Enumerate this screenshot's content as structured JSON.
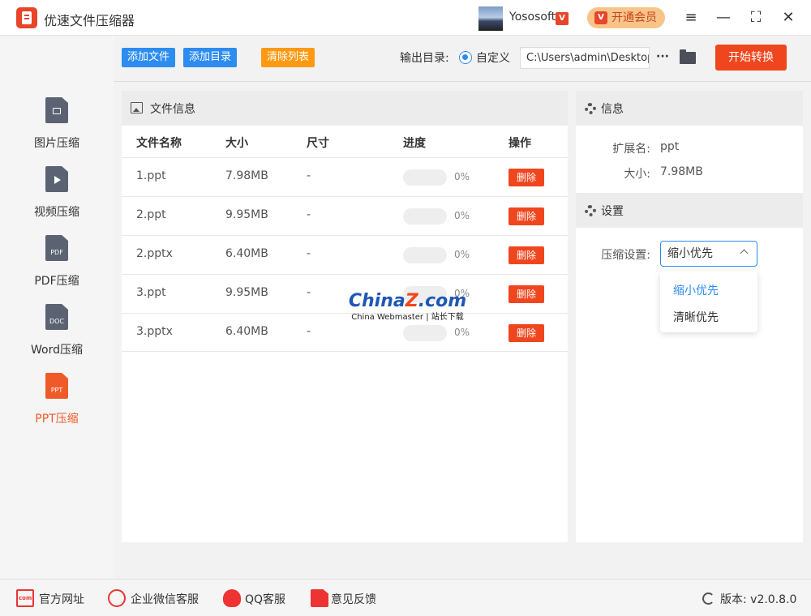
{
  "app": {
    "title": "优速文件压缩器"
  },
  "user": {
    "name": "Yososoft",
    "vip_badge": "V",
    "vip_button": "开通会员",
    "vip_icon": "V"
  },
  "window": {
    "menu": "≡",
    "minimize": "—",
    "maximize": "⛶",
    "close": "✕"
  },
  "sidebar": {
    "items": [
      {
        "label": "图片压缩",
        "tag": "",
        "icon": "image-file-icon"
      },
      {
        "label": "视频压缩",
        "tag": "",
        "icon": "video-file-icon"
      },
      {
        "label": "PDF压缩",
        "tag": "PDF",
        "icon": "pdf-file-icon"
      },
      {
        "label": "Word压缩",
        "tag": "DOC",
        "icon": "doc-file-icon"
      },
      {
        "label": "PPT压缩",
        "tag": "PPT",
        "icon": "ppt-file-icon",
        "active": true
      }
    ]
  },
  "toolbar": {
    "add_file": "添加文件",
    "add_dir": "添加目录",
    "clear_list": "清除列表",
    "output_label": "输出目录:",
    "radio_label": "自定义",
    "output_path": "C:\\Users\\admin\\Desktop",
    "more": "···",
    "start": "开始转换"
  },
  "file_panel": {
    "title": "文件信息",
    "columns": [
      "文件名称",
      "大小",
      "尺寸",
      "进度",
      "操作"
    ],
    "rows": [
      {
        "name": "1.ppt",
        "size": "7.98MB",
        "dims": "-",
        "progress": 0,
        "pct": "0%",
        "action": "删除"
      },
      {
        "name": "2.ppt",
        "size": "9.95MB",
        "dims": "-",
        "progress": 0,
        "pct": "0%",
        "action": "删除"
      },
      {
        "name": "2.pptx",
        "size": "6.40MB",
        "dims": "-",
        "progress": 0,
        "pct": "0%",
        "action": "删除"
      },
      {
        "name": "3.ppt",
        "size": "9.95MB",
        "dims": "-",
        "progress": 0,
        "pct": "0%",
        "action": "删除"
      },
      {
        "name": "3.pptx",
        "size": "6.40MB",
        "dims": "-",
        "progress": 0,
        "pct": "0%",
        "action": "删除"
      }
    ]
  },
  "watermark": {
    "main_a": "China",
    "main_b": "Z",
    "main_c": ".com",
    "sub": "China Webmaster | 站长下载"
  },
  "info_panel": {
    "title": "信息",
    "ext_label": "扩展名:",
    "ext_value": "ppt",
    "size_label": "大小:",
    "size_value": "7.98MB"
  },
  "settings": {
    "title": "设置",
    "compress_label": "压缩设置:",
    "selected": "缩小优先",
    "options": [
      "缩小优先",
      "清晰优先"
    ]
  },
  "footer": {
    "website": "官方网址",
    "wechat": "企业微信客服",
    "qq": "QQ客服",
    "feedback": "意见反馈",
    "version": "版本: v2.0.8.0"
  },
  "colors": {
    "primary": "#2d8cf0",
    "accent": "#f0461e",
    "clear_button": "#fd9a12",
    "vip_bg": "#f9c48a"
  }
}
